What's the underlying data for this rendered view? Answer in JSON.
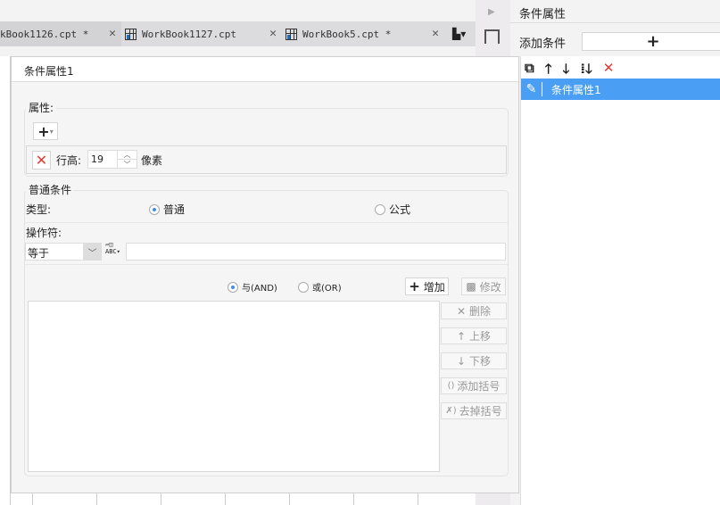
{
  "tabs": [
    {
      "label": "kBook1126.cpt *"
    },
    {
      "label": "WorkBook1127.cpt"
    },
    {
      "label": "WorkBook5.cpt *"
    }
  ],
  "right_panel": {
    "title": "条件属性",
    "add_condition_label": "添加条件",
    "add_button": "+",
    "items": [
      {
        "label": "条件属性1",
        "selected": true
      }
    ]
  },
  "dialog": {
    "title": "条件属性1",
    "properties_label": "属性:",
    "row_height_label": "行高:",
    "row_height_value": "19",
    "unit_label": "像素",
    "normal_condition_label": "普通条件",
    "type_label": "类型:",
    "type_options": [
      {
        "label": "普通",
        "selected": true
      },
      {
        "label": "公式",
        "selected": false
      }
    ],
    "operator_label": "操作符:",
    "operator_value": "等于",
    "value_input": "",
    "logic_options": [
      {
        "label": "与(AND)",
        "selected": true
      },
      {
        "label": "或(OR)",
        "selected": false
      }
    ],
    "buttons": {
      "add": "增加",
      "modify": "修改",
      "delete": "删除",
      "up": "上移",
      "down": "下移",
      "add_bracket": "添加括号",
      "remove_bracket": "去掉括号"
    }
  },
  "colors": {
    "selection": "#4a9ff5",
    "delete_red": "#e53935",
    "radio_accent": "#3a8ef0"
  }
}
